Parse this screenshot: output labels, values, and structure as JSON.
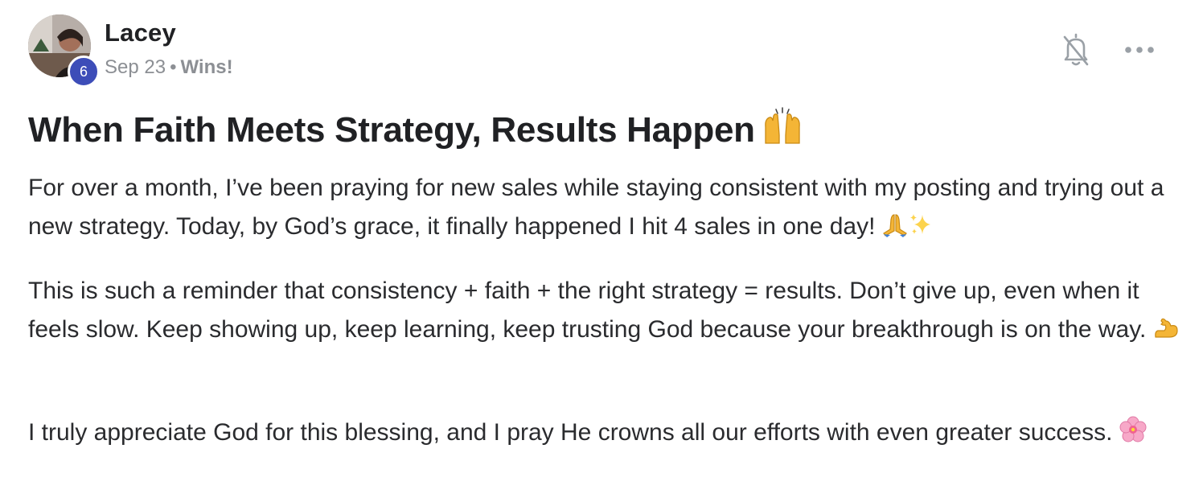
{
  "post": {
    "author": "Lacey",
    "level": "6",
    "date": "Sep 23",
    "separator": "•",
    "category": "Wins!",
    "title": "When Faith Meets Strategy, Results Happen",
    "title_emoji": "raising-hands-icon",
    "paragraphs": [
      {
        "text": "For over a month, I’ve been praying for new sales while staying consistent with my posting and trying out a new strategy. Today, by God’s grace, it finally happened I hit 4 sales in one day!",
        "emojis": [
          "folded-hands-icon",
          "sparkles-icon"
        ]
      },
      {
        "text": "This is such a reminder that consistency + faith + the right strategy = results. Don’t give up, even when it feels slow. Keep showing up, keep learning, keep trusting God because your breakthrough is on the way.",
        "emojis": [
          "flexed-biceps-icon"
        ]
      },
      {
        "text": "I truly appreciate God for this blessing, and I pray He crowns all our efforts with even greater success.",
        "emojis": [
          "cherry-blossom-icon"
        ]
      }
    ]
  },
  "actions": {
    "notifications_icon": "bell-off-icon",
    "more_icon": "more-horizontal-icon"
  },
  "colors": {
    "badge": "#3d4db8",
    "meta_text": "#8c8f94",
    "body_text": "#2a2b2e",
    "icon": "#9aa0a6"
  }
}
